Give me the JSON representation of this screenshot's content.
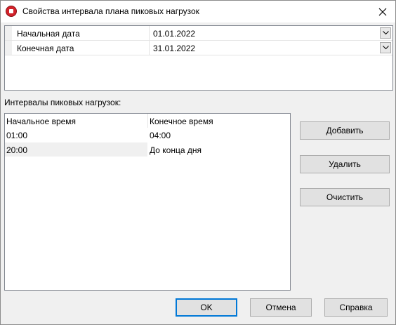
{
  "window": {
    "title": "Свойства интервала плана пиковых нагрузок",
    "icon": "app-icon",
    "close_icon": "close-icon"
  },
  "dates": {
    "rows": [
      {
        "label": "Начальная дата",
        "value": "01.01.2022"
      },
      {
        "label": "Конечная дата",
        "value": "31.01.2022"
      }
    ]
  },
  "intervals": {
    "label": "Интервалы пиковых нагрузок:",
    "columns": [
      "Начальное время",
      "Конечное время"
    ],
    "rows": [
      {
        "start": "01:00",
        "end": "04:00",
        "selected": false
      },
      {
        "start": "20:00",
        "end": "До конца дня",
        "selected": true
      }
    ]
  },
  "side_buttons": {
    "add": "Добавить",
    "delete": "Удалить",
    "clear": "Очистить"
  },
  "footer_buttons": {
    "ok": "OK",
    "cancel": "Отмена",
    "help": "Справка"
  },
  "colors": {
    "default_button_border": "#0078d7",
    "dialog_background": "#f0f0f0"
  }
}
